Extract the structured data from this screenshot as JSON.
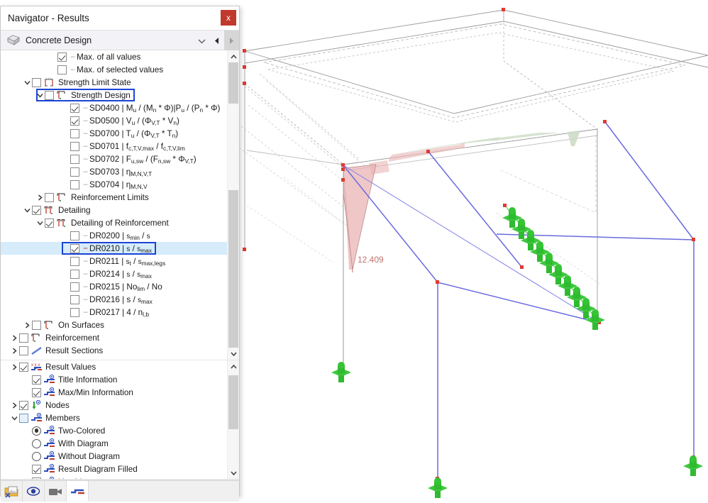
{
  "window": {
    "title": "Navigator - Results",
    "close_label": "x"
  },
  "header": {
    "label": "Concrete Design",
    "icon": "cube-icon",
    "collapse_icon": "chevron-down-icon",
    "prev_icon": "triangle-left-icon",
    "next_icon": "triangle-right-icon"
  },
  "tree_top": [
    {
      "indent": 4,
      "twist": "none",
      "control": "checkbox",
      "checked": true,
      "dash": "gray",
      "icon": "none",
      "label": "Max. of all values"
    },
    {
      "indent": 4,
      "twist": "none",
      "control": "checkbox",
      "checked": false,
      "dash": "gray",
      "icon": "none",
      "label": "Max. of selected values"
    },
    {
      "indent": 2,
      "twist": "open",
      "control": "checkbox",
      "checked": false,
      "dash": "none",
      "icon": "design-icon",
      "label": "Strength Limit State"
    },
    {
      "indent": 3,
      "twist": "open",
      "control": "checkbox",
      "checked": false,
      "dash": "none",
      "icon": "rebar-icon",
      "label": "Strength Design",
      "outlined": true
    },
    {
      "indent": 5,
      "twist": "none",
      "control": "checkbox",
      "checked": true,
      "dash": "gray",
      "icon": "none",
      "label": "SD0400 | M<sub>u</sub> / (M<sub>n</sub> * Φ)|P<sub>u</sub> / (P<sub>n</sub> * Φ)"
    },
    {
      "indent": 5,
      "twist": "none",
      "control": "checkbox",
      "checked": true,
      "dash": "gray",
      "icon": "none",
      "label": "SD0500 | V<sub>u</sub> / (Φ<sub>V,T</sub> * V<sub>n</sub>)"
    },
    {
      "indent": 5,
      "twist": "none",
      "control": "checkbox",
      "checked": false,
      "dash": "gray",
      "icon": "none",
      "label": "SD0700 | T<sub>u</sub> / (Φ<sub>V,T</sub> * T<sub>n</sub>)"
    },
    {
      "indent": 5,
      "twist": "none",
      "control": "checkbox",
      "checked": false,
      "dash": "gray",
      "icon": "none",
      "label": "SD0701 | f<sub>c,T,V,max</sub> / f<sub>c,T,V,lim</sub>"
    },
    {
      "indent": 5,
      "twist": "none",
      "control": "checkbox",
      "checked": false,
      "dash": "gray",
      "icon": "none",
      "label": "SD0702 | F<sub>u,sw</sub> / (F<sub>n,sw</sub> * Φ<sub>V,T</sub>)"
    },
    {
      "indent": 5,
      "twist": "none",
      "control": "checkbox",
      "checked": false,
      "dash": "gray",
      "icon": "none",
      "label": "SD0703 | η<sub>M,N,V,T</sub>"
    },
    {
      "indent": 5,
      "twist": "none",
      "control": "checkbox",
      "checked": false,
      "dash": "gray",
      "icon": "none",
      "label": "SD0704 | η<sub>M,N,V</sub>"
    },
    {
      "indent": 3,
      "twist": "closed",
      "control": "checkbox",
      "checked": false,
      "dash": "none",
      "icon": "rebar-icon",
      "label": "Reinforcement Limits"
    },
    {
      "indent": 2,
      "twist": "open",
      "control": "checkbox",
      "checked": true,
      "dash": "none",
      "icon": "detail-icon",
      "label": "Detailing"
    },
    {
      "indent": 3,
      "twist": "open",
      "control": "checkbox",
      "checked": true,
      "dash": "none",
      "icon": "detail-icon",
      "label": "Detailing of Reinforcement"
    },
    {
      "indent": 5,
      "twist": "none",
      "control": "checkbox",
      "checked": false,
      "dash": "gray",
      "icon": "none",
      "label": "DR0200 | <span class='sm'>s</span><sub>min</sub> / <span class='sm'>s</span>"
    },
    {
      "indent": 5,
      "twist": "none",
      "control": "checkbox",
      "checked": true,
      "dash": "red",
      "icon": "none",
      "label": "DR0210 | <span class='sm'>s</span> / <span class='sm'>s</span><sub>max</sub>",
      "outlined": true,
      "selected": true
    },
    {
      "indent": 5,
      "twist": "none",
      "control": "checkbox",
      "checked": false,
      "dash": "gray",
      "icon": "none",
      "label": "DR0211 | <span class='sm'>s</span><sub>t</sub> / <span class='sm'>s</span><sub>max,legs</sub>"
    },
    {
      "indent": 5,
      "twist": "none",
      "control": "checkbox",
      "checked": false,
      "dash": "gray",
      "icon": "none",
      "label": "DR0214 | <span class='sm'>s</span> / <span class='sm'>s</span><sub>max</sub>"
    },
    {
      "indent": 5,
      "twist": "none",
      "control": "checkbox",
      "checked": false,
      "dash": "gray",
      "icon": "none",
      "label": "DR0215 | No<sub>lim</sub> / No"
    },
    {
      "indent": 5,
      "twist": "none",
      "control": "checkbox",
      "checked": false,
      "dash": "gray",
      "icon": "none",
      "label": "DR0216 | s / <span class='sm'>s</span><sub>max</sub>"
    },
    {
      "indent": 5,
      "twist": "none",
      "control": "checkbox",
      "checked": false,
      "dash": "gray",
      "icon": "none",
      "label": "DR0217 | 4 / n<sub>l,b</sub>"
    },
    {
      "indent": 2,
      "twist": "closed",
      "control": "checkbox",
      "checked": false,
      "dash": "none",
      "icon": "rebar-icon",
      "label": "On Surfaces"
    },
    {
      "indent": 1,
      "twist": "closed",
      "control": "checkbox",
      "checked": false,
      "dash": "none",
      "icon": "rebar-icon",
      "label": "Reinforcement"
    },
    {
      "indent": 1,
      "twist": "closed",
      "control": "checkbox",
      "checked": false,
      "dash": "none",
      "icon": "section-icon",
      "label": "Result Sections"
    }
  ],
  "tree_bottom": [
    {
      "indent": 1,
      "twist": "closed",
      "control": "checkbox",
      "checked": true,
      "dash": "none",
      "icon": "values-icon",
      "label": "Result Values"
    },
    {
      "indent": 2,
      "twist": "none",
      "control": "checkbox",
      "checked": true,
      "dash": "none",
      "icon": "diagram-icon",
      "label": "Title Information"
    },
    {
      "indent": 2,
      "twist": "none",
      "control": "checkbox",
      "checked": true,
      "dash": "none",
      "icon": "diagram-icon",
      "label": "Max/Min Information"
    },
    {
      "indent": 1,
      "twist": "closed",
      "control": "checkbox",
      "checked": true,
      "dash": "none",
      "icon": "node-icon",
      "label": "Nodes"
    },
    {
      "indent": 1,
      "twist": "open",
      "control": "checkbox",
      "checked": "partial",
      "dash": "none",
      "icon": "diagram-icon",
      "label": "Members"
    },
    {
      "indent": 2,
      "twist": "none",
      "control": "radio",
      "checked": true,
      "dash": "none",
      "icon": "diagram-icon",
      "label": "Two-Colored"
    },
    {
      "indent": 2,
      "twist": "none",
      "control": "radio",
      "checked": false,
      "dash": "none",
      "icon": "diagram-icon",
      "label": "With Diagram"
    },
    {
      "indent": 2,
      "twist": "none",
      "control": "radio",
      "checked": false,
      "dash": "none",
      "icon": "diagram-icon",
      "label": "Without Diagram"
    },
    {
      "indent": 2,
      "twist": "none",
      "control": "checkbox",
      "checked": true,
      "dash": "none",
      "icon": "diagram-icon",
      "label": "Result Diagram Filled"
    },
    {
      "indent": 2,
      "twist": "none",
      "control": "checkbox",
      "checked": true,
      "dash": "none",
      "icon": "diagram-icon",
      "label": "Hatching"
    }
  ],
  "tabs": [
    {
      "name": "tab-project-navigator",
      "icon": "folder-image-icon",
      "active": false
    },
    {
      "name": "tab-display",
      "icon": "eye-icon",
      "active": false
    },
    {
      "name": "tab-views",
      "icon": "video-camera-icon",
      "active": false
    },
    {
      "name": "tab-results",
      "icon": "result-diagram-icon",
      "active": true
    }
  ],
  "viewport": {
    "result_label": "12.409",
    "label_color": "#c0736f",
    "member_color": "#6a6ae0",
    "node_color": "#e03a2f",
    "support_color": "#22c022",
    "diagram_negative_color": "#e8a8a8",
    "diagram_positive_color": "#b9d4b0",
    "geometry_color": "#9a9a9a"
  }
}
